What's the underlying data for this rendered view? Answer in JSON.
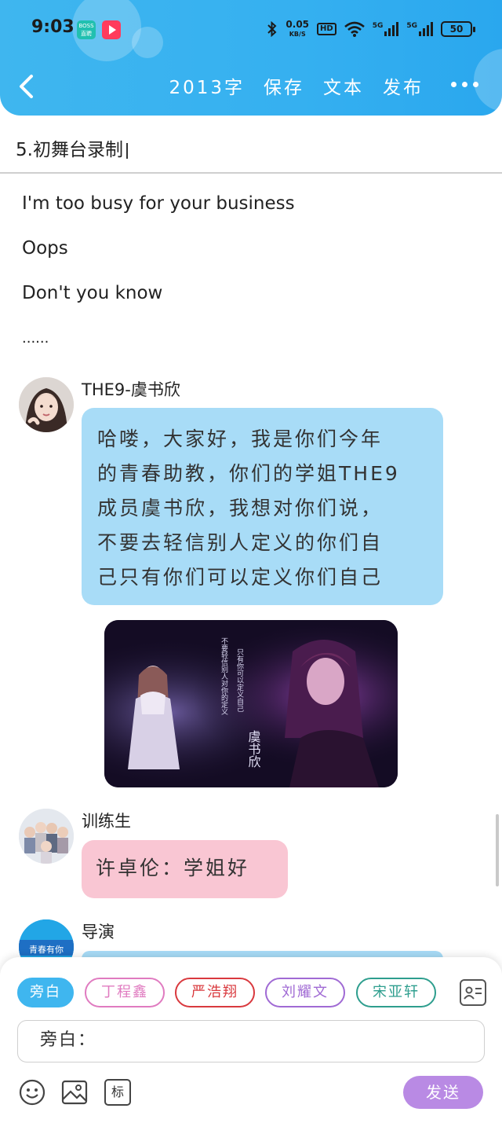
{
  "status_bar": {
    "time": "9:03",
    "app_badge_boss": "BOSS 直聘",
    "net_speed_value": "0.05",
    "net_speed_unit": "KB/S",
    "hd_label": "HD",
    "signal_1": "5G",
    "signal_2": "5G",
    "battery": "50"
  },
  "header": {
    "actions": [
      "2013字",
      "保存",
      "文本",
      "发布"
    ]
  },
  "document": {
    "title": "5.初舞台录制"
  },
  "lyrics": [
    "I'm too busy for your business",
    "Oops",
    "Don't you know",
    "......"
  ],
  "messages": [
    {
      "sender": "THE9-虞书欣",
      "lines": [
        "哈喽，大家好，我是你们今年",
        "的青春助教，你们的学姐THE9",
        "成员虞书欣，我想对你们说，",
        "不要去轻信别人定义的你们自",
        "己只有你们可以定义你们自己"
      ]
    },
    {
      "sender": "训练生",
      "text": "许卓伦：学姐好"
    },
    {
      "sender": "导演",
      "avatar_text": "青春有你"
    }
  ],
  "image_caption": {
    "left_column": "不要轻信别人对你的定义",
    "right_column": "只有你可以定义自己",
    "name": "虞书欣"
  },
  "composer": {
    "roles": [
      "旁白",
      "丁程鑫",
      "严浩翔",
      "刘耀文",
      "宋亚轩"
    ],
    "input_value": "旁白：",
    "tag_label": "标",
    "send_label": "发送"
  },
  "colors": {
    "accent": "#3fb6ef",
    "bubble_blue": "#a8dcf7",
    "bubble_pink": "#f9c6d3",
    "send": "#b98ae4",
    "chip_pink": "#e07bc0",
    "chip_red": "#d9393e",
    "chip_purple": "#a06ad4",
    "chip_teal": "#2e9e8e"
  }
}
